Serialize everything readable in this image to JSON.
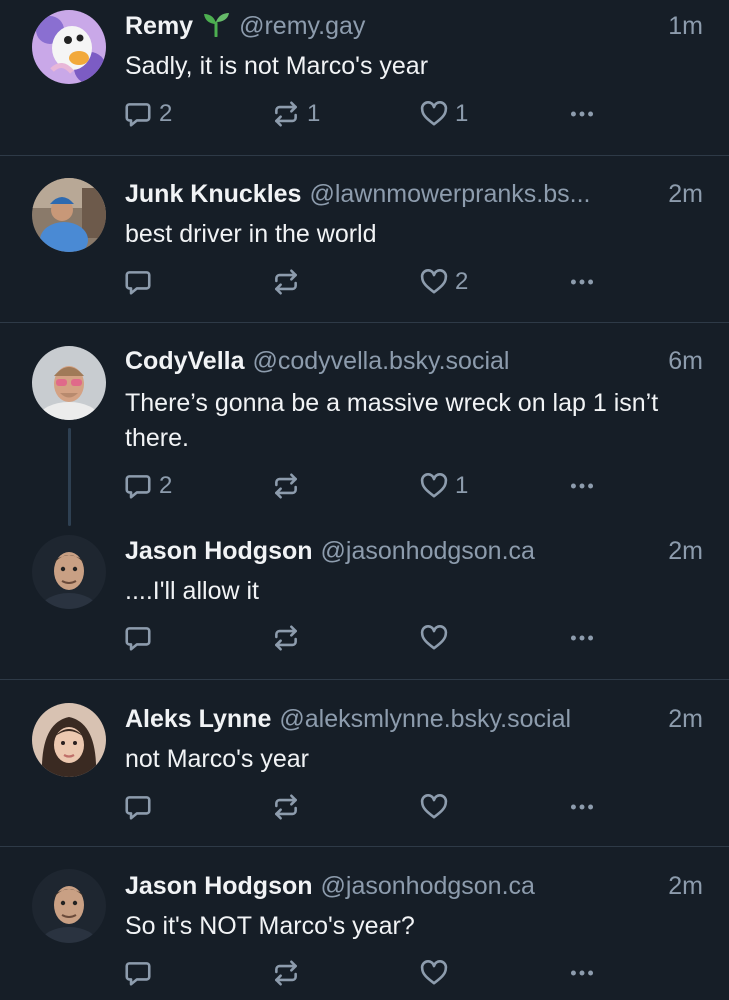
{
  "colors": {
    "background": "#161e27",
    "divider": "#2e3a47",
    "text_primary": "#f1f3f5",
    "text_secondary": "#8d9cad",
    "sprout": "#4caf50"
  },
  "posts": [
    {
      "author": "Remy",
      "handle": "@remy.gay",
      "time": "1m",
      "text": "Sadly, it is not Marco's year",
      "reply_count": "2",
      "repost_count": "1",
      "like_count": "1",
      "author_emoji_icon": "sprout-icon"
    },
    {
      "author": "Junk Knuckles",
      "handle": "@lawnmowerpranks.bs...",
      "time": "2m",
      "text": "best driver in the world",
      "reply_count": "",
      "repost_count": "",
      "like_count": "2"
    },
    {
      "author": "CodyVella",
      "handle": "@codyvella.bsky.social",
      "time": "6m",
      "text": "There’s gonna be a massive wreck on lap 1 isn’t there.",
      "reply_count": "2",
      "repost_count": "",
      "like_count": "1"
    },
    {
      "author": "Jason Hodgson",
      "handle": "@jasonhodgson.ca",
      "time": "2m",
      "text": "....I'll allow it",
      "reply_count": "",
      "repost_count": "",
      "like_count": ""
    },
    {
      "author": "Aleks Lynne",
      "handle": "@aleksmlynne.bsky.social",
      "time": "2m",
      "text": "not Marco's year",
      "reply_count": "",
      "repost_count": "",
      "like_count": ""
    },
    {
      "author": "Jason Hodgson",
      "handle": "@jasonhodgson.ca",
      "time": "2m",
      "text": "So it's NOT Marco's year?",
      "reply_count": "",
      "repost_count": "",
      "like_count": ""
    }
  ],
  "icons": {
    "reply": "reply-icon",
    "repost": "repost-icon",
    "like": "heart-icon",
    "more": "more-options-icon"
  }
}
